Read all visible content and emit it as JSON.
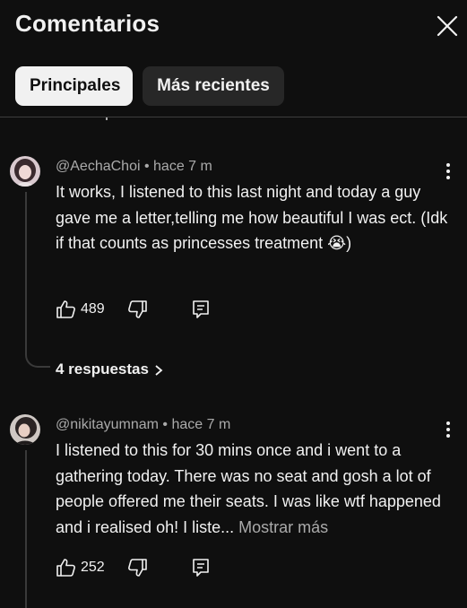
{
  "header": {
    "title": "Comentarios",
    "tabs": [
      {
        "label": "Principales",
        "active": true
      },
      {
        "label": "Más recientes",
        "active": false
      }
    ],
    "close_icon": "close-icon"
  },
  "comments": [
    {
      "author": "@AechaChoi",
      "time": "hace 7 m",
      "text": "It works, I listened to this last night and today a guy gave me a letter,telling me how beautiful I was ect. (Idk if that counts as princesses treatment 😭)",
      "likes": "489",
      "replies_label": "4 respuestas"
    },
    {
      "author": "@nikitayumnam",
      "time": "hace 7 m",
      "text": "I listened to this for 30 mins once and i went to a gathering today. There was no seat and gosh a lot of people offered me their seats. I was like wtf happened and i realised oh! I liste...",
      "show_more": "Mostrar más",
      "likes": "252"
    }
  ],
  "separator": "•",
  "colors": {
    "background": "#0f0f0f",
    "text": "#f1f1f1",
    "secondary": "#aaaaaa",
    "chip_inactive": "#272727"
  }
}
